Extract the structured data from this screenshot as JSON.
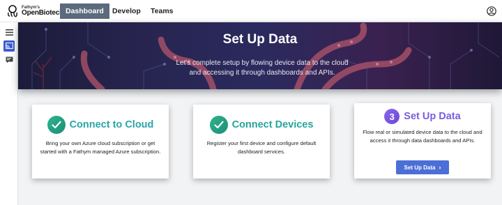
{
  "brand": {
    "small": "Fathym's",
    "name": "OpenBiotech"
  },
  "nav": {
    "tabs": [
      {
        "label": "Dashboard"
      },
      {
        "label": "Develop"
      },
      {
        "label": "Teams"
      }
    ]
  },
  "hero": {
    "title": "Set Up Data",
    "subtitle": "Let's complete setup by flowing device data to the cloud and accessing it through dashboards and APIs."
  },
  "cards": [
    {
      "title": "Connect to Cloud",
      "badge": "check-icon",
      "description": "Bring your own Azure cloud subscription or get started with a Fathym managed Azure subscription."
    },
    {
      "title": "Connect Devices",
      "badge": "check-icon",
      "description": "Register your first device and configure default dashboard services."
    },
    {
      "title": "Set Up Data",
      "badge_number": "3",
      "description": "Flow real or simulated device data to the cloud and access it through data dashboards and APIs.",
      "button_label": "Set Up Data"
    }
  ],
  "colors": {
    "accent": "#4b6fd6",
    "nav_active": "#5b6a7c",
    "check": "#1b8e78",
    "step_purple": "#7a5fe0"
  }
}
